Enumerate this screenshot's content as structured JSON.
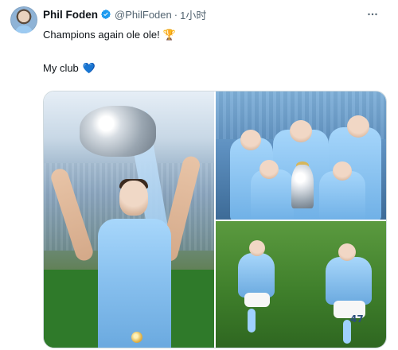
{
  "tweet": {
    "display_name": "Phil Foden",
    "handle": "@PhilFoden",
    "separator": "·",
    "time": "1小时",
    "text_line1": "Champions again ole ole!",
    "text_line2": "My club",
    "emoji_trophy": "🏆",
    "emoji_heart": "💙",
    "jersey_number": "47"
  },
  "icons": {
    "verified": "verified-badge-icon",
    "more": "more-icon",
    "trophy": "trophy-emoji",
    "heart": "blue-heart-emoji"
  },
  "colors": {
    "text_primary": "#0f1419",
    "text_secondary": "#536471",
    "verified_blue": "#1d9bf0",
    "media_border": "#cfd9de"
  }
}
